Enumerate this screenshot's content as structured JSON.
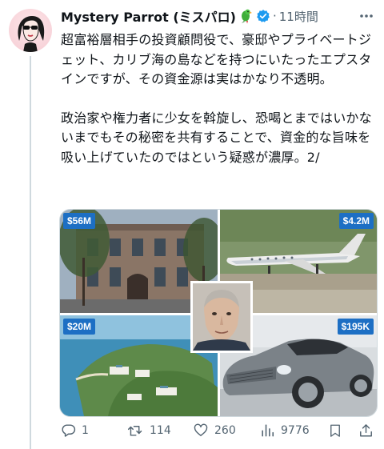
{
  "tweet": {
    "author_name": "Mystery Parrot (ミスパロ)",
    "time": "11時間",
    "dot": "·",
    "paragraph1": "超富裕層相手の投資顧問役で、豪邸やプライベートジェット、カリブ海の島などを持つにいたったエプスタインですが、その資金源は実はかなり不透明。",
    "paragraph2": "政治家や権力者に少女を斡旋し、恐喝とまではいかないまでもその秘密を共有することで、資金的な旨味を吸い上げていたのではという疑惑が濃厚。2/"
  },
  "media": {
    "price_tl": "$56M",
    "price_tr": "$4.2M",
    "price_bl": "$20M",
    "price_br": "$195K"
  },
  "actions": {
    "reply_count": "1",
    "retweet_count": "114",
    "like_count": "260",
    "view_count": "9776"
  },
  "icons": [
    "parrot-icon",
    "verified-icon",
    "more-icon",
    "reply-icon",
    "retweet-icon",
    "like-icon",
    "views-icon",
    "bookmark-icon",
    "share-icon"
  ],
  "colors": {
    "verified": "#1d9bf0",
    "price_badge": "#1d6fc4",
    "secondary_text": "#536471"
  }
}
